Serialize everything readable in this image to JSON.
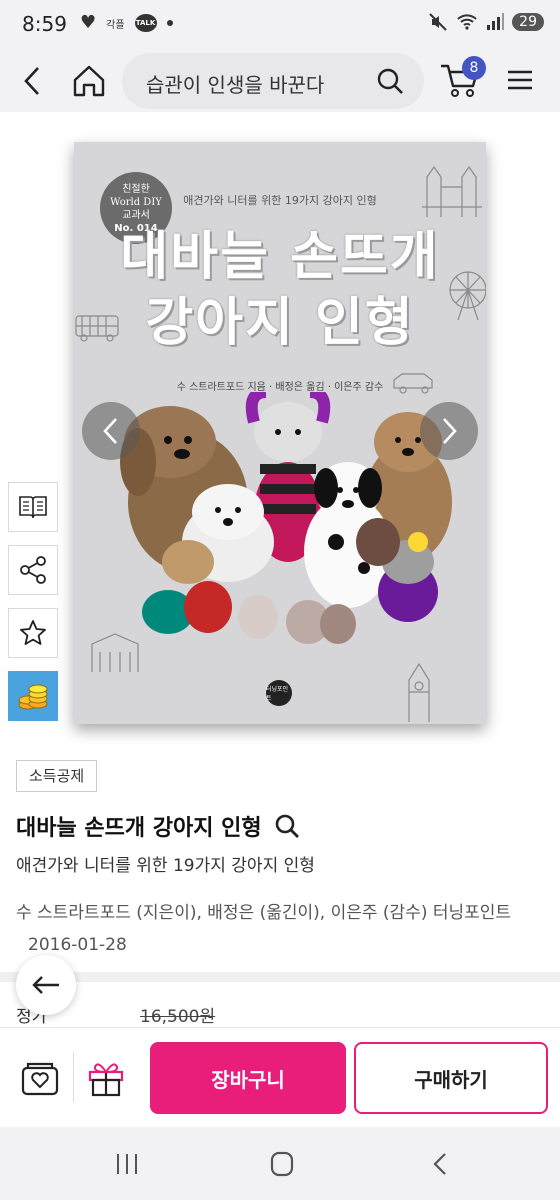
{
  "status_bar": {
    "time": "8:59",
    "small_label": "각플",
    "talk_label": "TALK",
    "battery": "29"
  },
  "header": {
    "search_text": "습관이 인생을 바꾼다",
    "cart_count": "8"
  },
  "cover": {
    "badge_line1": "친절한",
    "badge_line2": "World DIY",
    "badge_line3": "교과서",
    "badge_line4": "No. 014",
    "subtitle": "애견가와 니터를 위한 19가지 강아지 인형",
    "title_line1": "대바늘 손뜨개",
    "title_line2": "강아지 인형",
    "author_line": "수 스트라트포드 지음 · 배정은 옮김 · 이은주 감수",
    "publisher_logo": "터닝포인트"
  },
  "product": {
    "tag": "소득공제",
    "title": "대바늘 손뜨개 강아지 인형",
    "subtitle": "애견가와 니터를 위한 19가지 강아지 인형",
    "authors": "수 스트라트포드 (지은이), 배정은 (옮긴이), 이은주 (감수)   터닝포인트",
    "date": "2016-01-28",
    "price_label": "정가",
    "price_value": "16,500원"
  },
  "actions": {
    "add_to_cart": "장바구니",
    "buy_now": "구매하기"
  },
  "colors": {
    "accent": "#e91e7b",
    "badge_blue": "#4354c4"
  }
}
